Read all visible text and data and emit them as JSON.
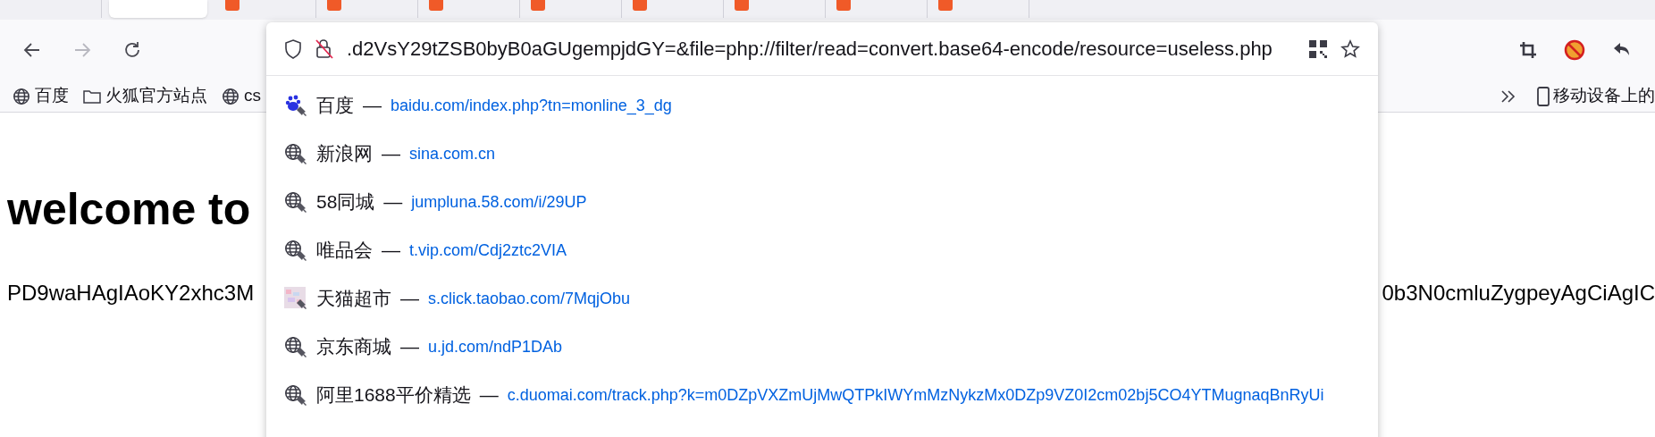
{
  "tabs": [
    {
      "selected": false,
      "favicon": false
    },
    {
      "selected": true,
      "favicon": false
    },
    {
      "selected": false,
      "favicon": true
    },
    {
      "selected": false,
      "favicon": true
    },
    {
      "selected": false,
      "favicon": true
    },
    {
      "selected": false,
      "favicon": true
    },
    {
      "selected": false,
      "favicon": true
    },
    {
      "selected": false,
      "favicon": true
    },
    {
      "selected": false,
      "favicon": true
    },
    {
      "selected": false,
      "favicon": true
    }
  ],
  "nav_buttons": [
    {
      "kind": "back",
      "disabled": false
    },
    {
      "kind": "forward",
      "disabled": true
    },
    {
      "kind": "reload",
      "disabled": false
    }
  ],
  "address_bar": {
    "value": ".d2VsY29tZSB0byB0aGUgempjdGY=&file=php://filter/read=convert.base64-encode/resource=useless.php"
  },
  "suggestions": [
    {
      "kind": "paw",
      "title": "百度",
      "dash": "—",
      "url": "baidu.com/index.php?tn=monline_3_dg"
    },
    {
      "kind": "globe",
      "title": "新浪网",
      "dash": "—",
      "url": "sina.com.cn"
    },
    {
      "kind": "globe",
      "title": "58同城",
      "dash": "—",
      "url": "jumpluna.58.com/i/29UP"
    },
    {
      "kind": "globe",
      "title": "唯品会",
      "dash": "—",
      "url": "t.vip.com/Cdj2ztc2VIA"
    },
    {
      "kind": "mosaic",
      "title": "天猫超市",
      "dash": "—",
      "url": "s.click.taobao.com/7MqjObu"
    },
    {
      "kind": "globe",
      "title": "京东商城",
      "dash": "—",
      "url": "u.jd.com/ndP1DAb"
    },
    {
      "kind": "globe",
      "title": "阿里1688平价精选",
      "dash": "—",
      "url": "c.duomai.com/track.php?k=m0DZpVXZmUjMwQTPkIWYmMzNykzMx0DZp9VZ0I2cm02bj5CO4YTMugnaqBnRyUi"
    }
  ],
  "bookmarks": [
    {
      "kind": "globe",
      "label": "百度"
    },
    {
      "kind": "folder",
      "label": "火狐官方站点"
    },
    {
      "kind": "globe",
      "label": "cs"
    }
  ],
  "mobile_bookmarks": {
    "label": "移动设备上的"
  },
  "page": {
    "heading": "welcome to",
    "text_left": "PD9waHAgIAoKY2xhc3M",
    "text_right": "0b3N0cmluZygpeyAgCiAgIC"
  }
}
